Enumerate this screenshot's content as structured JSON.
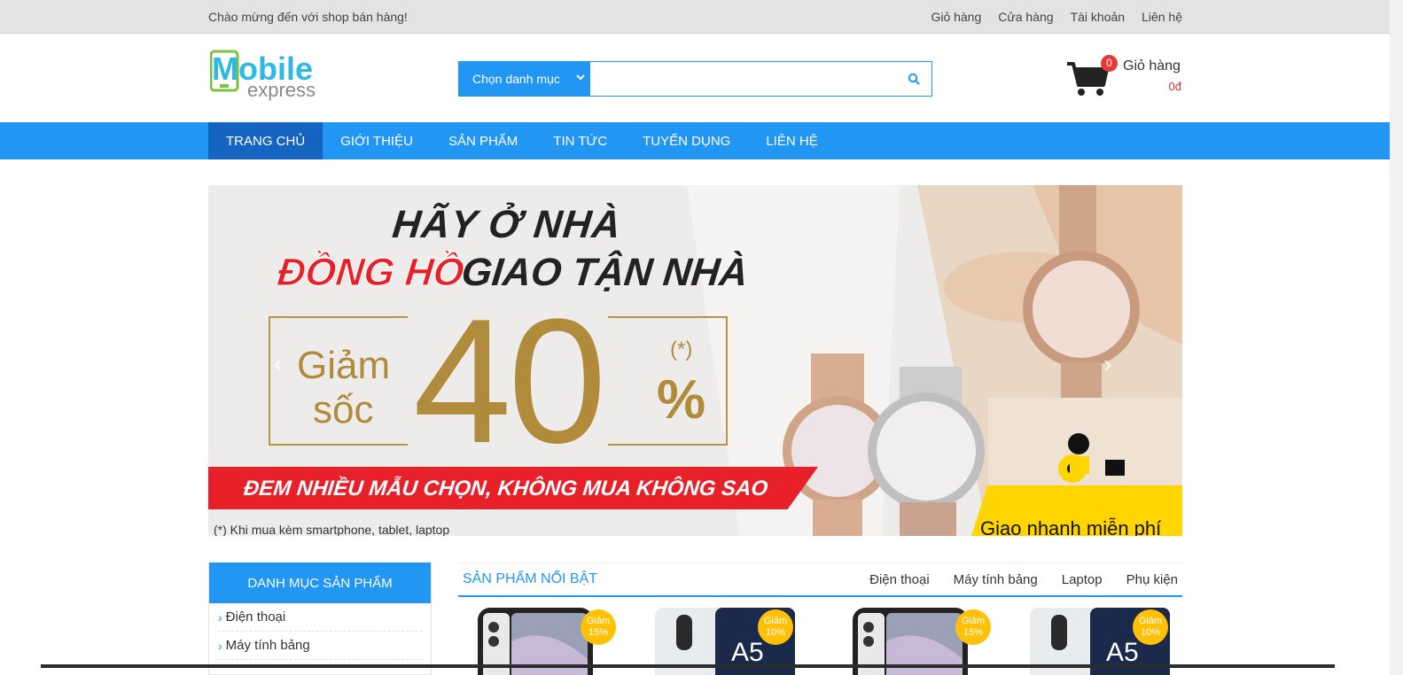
{
  "topbar": {
    "welcome": "Chào mừng đến với shop bán hàng!",
    "links": [
      "Giỏ hàng",
      "Cửa hàng",
      "Tài khoản",
      "Liên hệ"
    ]
  },
  "logo": {
    "line1": "Mobile",
    "line2": "express"
  },
  "search": {
    "category_label": "Chọn danh mục",
    "placeholder": ""
  },
  "cart": {
    "count": "0",
    "label": "Giỏ hàng",
    "total": "0đ"
  },
  "nav": {
    "items": [
      "TRANG CHỦ",
      "GIỚI THIỆU",
      "SẢN PHẨM",
      "TIN TỨC",
      "TUYỂN DỤNG",
      "LIÊN HỆ"
    ]
  },
  "banner": {
    "line1": "HÃY Ở NHÀ",
    "line2_red": "ĐỒNG HỒ",
    "line2_dark": "GIAO TẬN NHÀ",
    "giam": "Giảm",
    "soc": "sốc",
    "number": "40",
    "percent": "%",
    "star": "(*)",
    "red_text": "ĐEM NHIỀU MẪU CHỌN, KHÔNG MUA KHÔNG SAO",
    "note": "(*) Khi mua kèm smartphone, tablet, laptop",
    "shipping": "Giao nhanh miễn phí"
  },
  "sidebar": {
    "title": "DANH MỤC SẢN PHẨM",
    "items": [
      "Điện thoại",
      "Máy tính bảng"
    ]
  },
  "featured": {
    "title": "SẢN PHẨM NỔI BẬT",
    "tabs": [
      "Điện thoại",
      "Máy tính bảng",
      "Laptop",
      "Phụ kiện"
    ],
    "products": [
      {
        "sale_label": "Giảm",
        "sale_value": "15%"
      },
      {
        "sale_label": "Giảm",
        "sale_value": "10%"
      },
      {
        "sale_label": "Giảm",
        "sale_value": "15%"
      },
      {
        "sale_label": "Giảm",
        "sale_value": "10%"
      }
    ]
  },
  "colors": {
    "primary": "#2196f3",
    "nav_active": "#1565c0",
    "badge": "#e53935",
    "sale": "#ffc107",
    "gold": "#b08b3b",
    "promo_red": "#e8202a"
  }
}
